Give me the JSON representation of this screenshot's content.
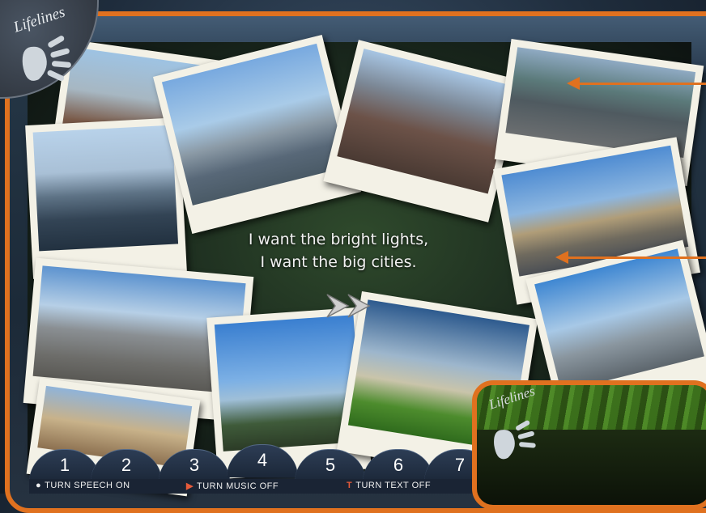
{
  "app": {
    "logo_text": "Lifelines"
  },
  "message": {
    "line1": "I want the bright lights,",
    "line2": "I want the big cities."
  },
  "next_button": {
    "icon": "double-chevron-right-icon"
  },
  "chapters": [
    "1",
    "2",
    "3",
    "4",
    "5",
    "6",
    "7"
  ],
  "controls": {
    "speech_label": "TURN SPEECH ON",
    "music_label": "TURN MUSIC OFF",
    "text_label": "TURN TEXT OFF"
  },
  "photos": [
    "city-rooftops-photo",
    "arch-bridge-photo",
    "old-town-aerial-photo",
    "modern-city-aerial-photo",
    "suspension-bridge-skyline-photo",
    "tower-bridge-photo",
    "city-panorama-photo",
    "tv-tower-photo",
    "eiffel-tower-photo",
    "financial-district-photo",
    "brandenburg-gate-photo"
  ],
  "colors": {
    "frame": "#e0711f",
    "tab": "#24324a"
  },
  "inset": {
    "logo_text": "Lifelines"
  }
}
